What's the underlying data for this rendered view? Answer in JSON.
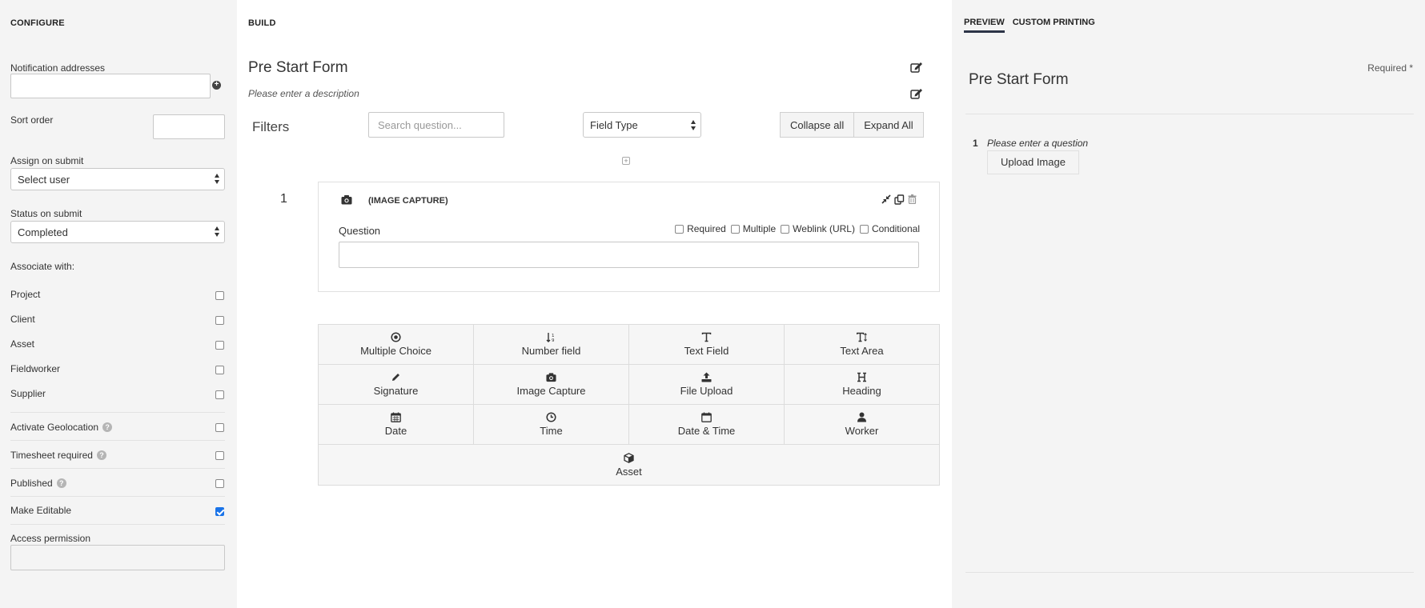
{
  "configure": {
    "title": "CONFIGURE",
    "notification_label": "Notification addresses",
    "sort_order_label": "Sort order",
    "assign_label": "Assign on submit",
    "assign_value": "Select user",
    "status_label": "Status on submit",
    "status_value": "Completed",
    "associate_label": "Associate with:",
    "associate_items": [
      {
        "label": "Project",
        "checked": false
      },
      {
        "label": "Client",
        "checked": false
      },
      {
        "label": "Asset",
        "checked": false
      },
      {
        "label": "Fieldworker",
        "checked": false
      },
      {
        "label": "Supplier",
        "checked": false
      }
    ],
    "geolocation_label": "Activate Geolocation",
    "timesheet_label": "Timesheet required",
    "published_label": "Published",
    "editable_label": "Make Editable",
    "editable_checked": true,
    "access_label": "Access permission",
    "help_glyph": "?"
  },
  "build": {
    "title": "BUILD",
    "form_title": "Pre Start Form",
    "form_description": "Please enter a description",
    "filters_label": "Filters",
    "search_placeholder": "Search question...",
    "field_type_value": "Field Type",
    "collapse_label": "Collapse all",
    "expand_label": "Expand All",
    "question": {
      "number": "1",
      "type_label": "(IMAGE CAPTURE)",
      "question_label": "Question",
      "options": [
        "Required",
        "Multiple",
        "Weblink (URL)",
        "Conditional"
      ]
    },
    "field_types": [
      [
        "Multiple Choice",
        "Number field",
        "Text Field",
        "Text Area"
      ],
      [
        "Signature",
        "Image Capture",
        "File Upload",
        "Heading"
      ],
      [
        "Date",
        "Time",
        "Date & Time",
        "Worker"
      ],
      [
        "Asset"
      ]
    ]
  },
  "preview": {
    "tab_preview": "PREVIEW",
    "tab_custom": "CUSTOM PRINTING",
    "required_note": "Required *",
    "form_title": "Pre Start Form",
    "question_number": "1",
    "question_text": "Please enter a question",
    "upload_label": "Upload Image"
  },
  "colors": {
    "panel_bg": "#f4f4f4",
    "accent_tab": "#2c3447",
    "checkbox_checked": "#1a73e8"
  }
}
